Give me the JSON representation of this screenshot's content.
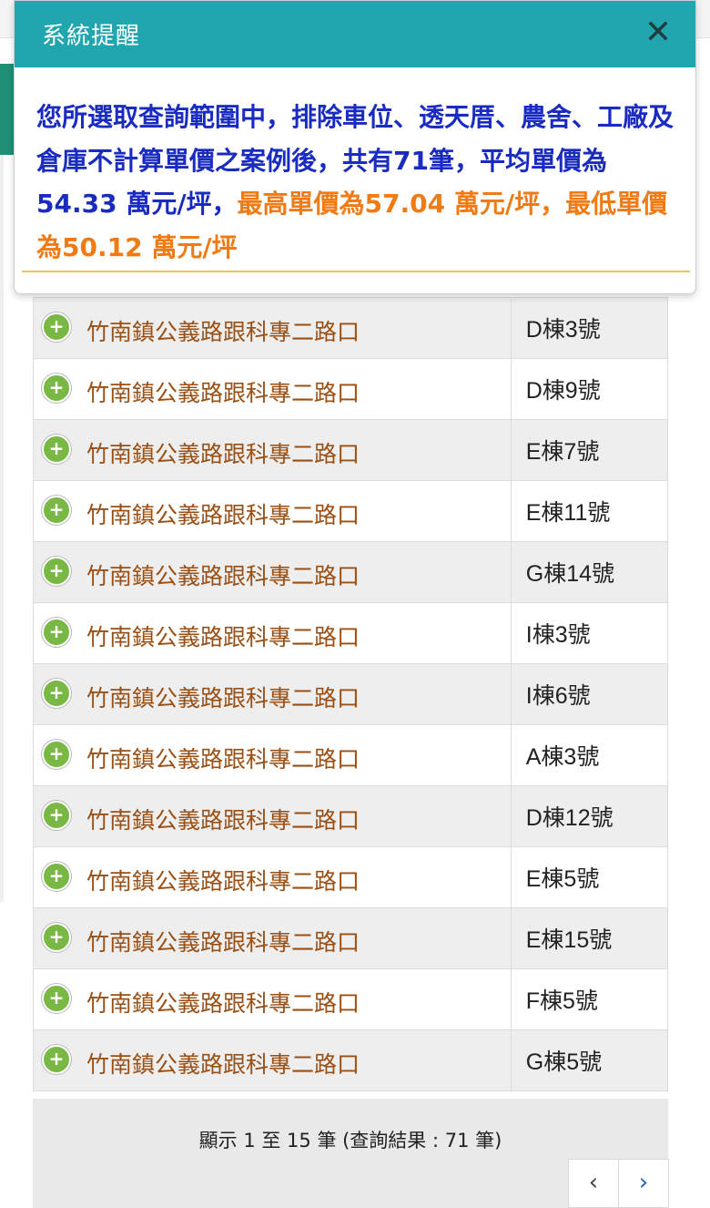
{
  "modal": {
    "title": "系統提醒",
    "close_icon": "✕",
    "message_blue": "您所選取查詢範圍中，排除車位、透天厝、農舍、工廠及倉庫不計算單價之案例後，共有71筆，平均單價為54.33 萬元/坪，",
    "message_orange": "最高單價為57.04 萬元/坪，最低單價為50.12 萬元/坪"
  },
  "rows": [
    {
      "location": "竹南鎮公義路跟科專二路口",
      "number": "D棟3號"
    },
    {
      "location": "竹南鎮公義路跟科專二路口",
      "number": "D棟9號"
    },
    {
      "location": "竹南鎮公義路跟科專二路口",
      "number": "E棟7號"
    },
    {
      "location": "竹南鎮公義路跟科專二路口",
      "number": "E棟11號"
    },
    {
      "location": "竹南鎮公義路跟科專二路口",
      "number": "G棟14號"
    },
    {
      "location": "竹南鎮公義路跟科專二路口",
      "number": "I棟3號"
    },
    {
      "location": "竹南鎮公義路跟科專二路口",
      "number": "I棟6號"
    },
    {
      "location": "竹南鎮公義路跟科專二路口",
      "number": "A棟3號"
    },
    {
      "location": "竹南鎮公義路跟科專二路口",
      "number": "D棟12號"
    },
    {
      "location": "竹南鎮公義路跟科專二路口",
      "number": "E棟5號"
    },
    {
      "location": "竹南鎮公義路跟科專二路口",
      "number": "E棟15號"
    },
    {
      "location": "竹南鎮公義路跟科專二路口",
      "number": "F棟5號"
    },
    {
      "location": "竹南鎮公義路跟科專二路口",
      "number": "G棟5號"
    }
  ],
  "expand_icon": "+",
  "footer": {
    "info": "顯示 1 至 15 筆 (查詢結果 : 71 筆)",
    "prev_icon": "‹",
    "next_icon": "›"
  }
}
